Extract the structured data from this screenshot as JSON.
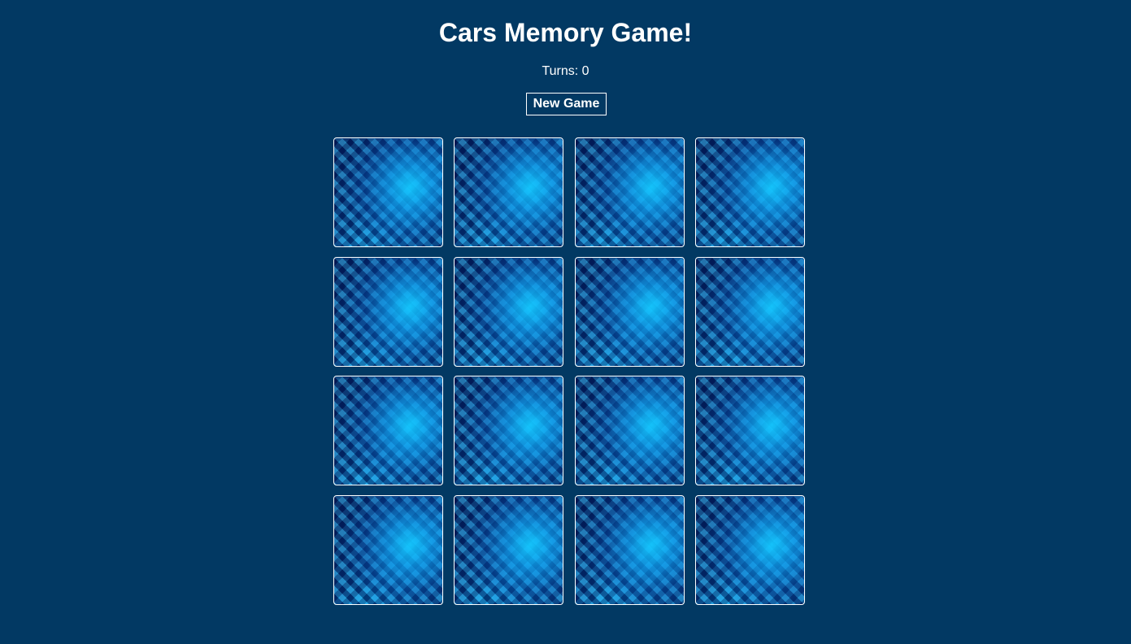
{
  "header": {
    "title": "Cars Memory Game!",
    "turns_text": "Turns: 0",
    "new_game_label": "New Game"
  },
  "board": {
    "card_count": 16,
    "columns": 4,
    "cards": [
      {
        "state": "face-down"
      },
      {
        "state": "face-down"
      },
      {
        "state": "face-down"
      },
      {
        "state": "face-down"
      },
      {
        "state": "face-down"
      },
      {
        "state": "face-down"
      },
      {
        "state": "face-down"
      },
      {
        "state": "face-down"
      },
      {
        "state": "face-down"
      },
      {
        "state": "face-down"
      },
      {
        "state": "face-down"
      },
      {
        "state": "face-down"
      },
      {
        "state": "face-down"
      },
      {
        "state": "face-down"
      },
      {
        "state": "face-down"
      },
      {
        "state": "face-down"
      }
    ]
  },
  "colors": {
    "background": "#023963",
    "text": "#ffffff",
    "card_border": "#ffffff",
    "card_pattern_primary": "#0788d8",
    "card_pattern_dark": "#051a5f"
  }
}
